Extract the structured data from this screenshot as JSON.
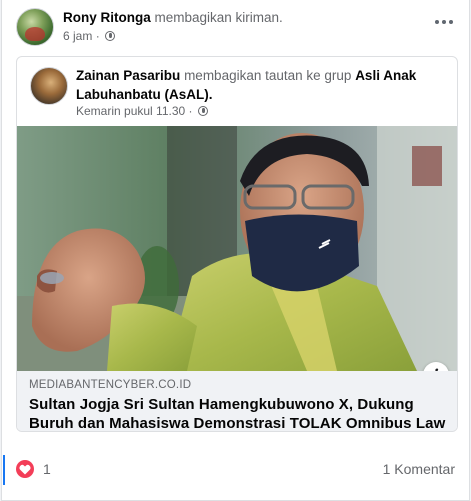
{
  "post": {
    "author": "Rony Ritonga",
    "action": "membagikan kiriman.",
    "time": "6 jam",
    "dot": "·",
    "more_icon": "more-horizontal-icon"
  },
  "shared_post": {
    "author": "Zainan Pasaribu",
    "action": "membagikan tautan ke grup",
    "group": "Asli Anak Labuhanbatu (AsAL).",
    "time": "Kemarin pukul 11.30",
    "dot": "·"
  },
  "link": {
    "domain": "MEDIABANTENCYBER.CO.ID",
    "title": "Sultan Jogja Sri Sultan Hamengkubuwono X, Dukung Buruh dan Mahasiswa Demonstrasi TOLAK Omnibus Law ...",
    "info_label": "i"
  },
  "engagement": {
    "reaction_count": "1",
    "comments": "1 Komentar",
    "reaction_color": "#f33e58"
  }
}
